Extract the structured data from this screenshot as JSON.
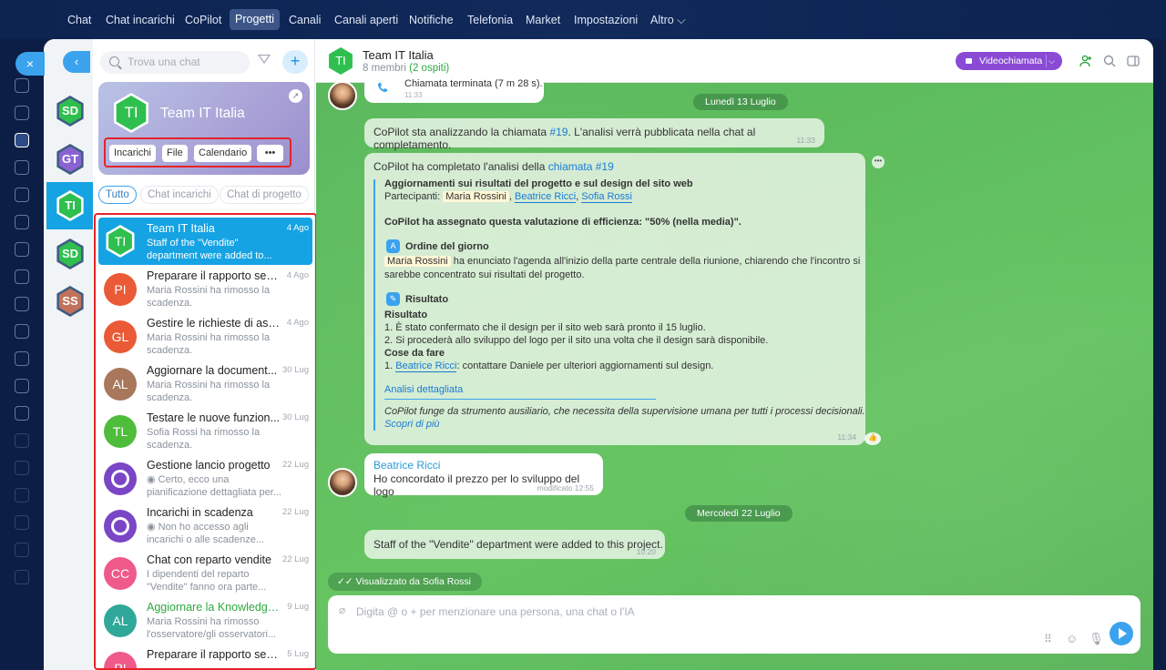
{
  "topnav": [
    "Chat",
    "Chat incarichi",
    "CoPilot",
    "Progetti",
    "Canali",
    "Canali aperti",
    "Notifiche",
    "Telefonia",
    "Market",
    "Impostazioni",
    "Altro ⌵"
  ],
  "active_nav": "Progetti",
  "close_label": "×",
  "back_label": "‹",
  "avatars_col": [
    {
      "initials": "SD",
      "color": "#2fbf4f"
    },
    {
      "initials": "GT",
      "color": "#8a63d2"
    },
    {
      "initials": "TI",
      "color": "#2fbf4f"
    },
    {
      "initials": "SD",
      "color": "#2fbf4f"
    },
    {
      "initials": "SS",
      "color": "#c0735a"
    }
  ],
  "search": {
    "placeholder": "Trova una chat"
  },
  "add_label": "+",
  "project_card": {
    "initials": "TI",
    "title": "Team IT Italia",
    "buttons": [
      "Incarichi",
      "File",
      "Calendario",
      "•••"
    ]
  },
  "tabs": [
    "Tutto",
    "Chat incarichi",
    "Chat di progetto"
  ],
  "chats": [
    {
      "title": "Team IT Italia",
      "date": "4 Ago",
      "sub": "Staff of the \"Vendite\" department were added to...",
      "initials": "TI",
      "kind": "hex",
      "selected": true
    },
    {
      "title": "Preparare il rapporto setti...",
      "date": "4 Ago",
      "sub": "Maria Rossini ha rimosso la scadenza.",
      "initials": "PI",
      "color": "#ea5a36"
    },
    {
      "title": "Gestire le richieste di assi...",
      "date": "4 Ago",
      "sub": "Maria Rossini ha rimosso la scadenza.",
      "initials": "GL",
      "color": "#ea5a36"
    },
    {
      "title": "Aggiornare la document...",
      "date": "30 Lug",
      "sub": "Maria Rossini ha rimosso la scadenza.",
      "initials": "AL",
      "color": "#a8775c"
    },
    {
      "title": "Testare le nuove funzion...",
      "date": "30 Lug",
      "sub": "Sofia Rossi ha rimosso la scadenza.",
      "initials": "TL",
      "color": "#4fbd3c"
    },
    {
      "title": "Gestione lancio progetto",
      "date": "22 Lug",
      "sub": "◉ Certo, ecco una pianificazione dettagliata per...",
      "kind": "bot"
    },
    {
      "title": "Incarichi in scadenza",
      "date": "22 Lug",
      "sub": "◉ Non ho accesso agli incarichi o alle scadenze...",
      "kind": "bot"
    },
    {
      "title": "Chat con reparto vendite",
      "date": "22 Lug",
      "sub": "I dipendenti del reparto \"Vendite\" fanno ora parte...",
      "initials": "CC",
      "color": "#ef5a8a"
    },
    {
      "title": "Aggiornare la Knowledge ...",
      "date": "9 Lug",
      "sub": "Maria Rossini ha rimosso l'osservatore/gli osservatori...",
      "initials": "AL",
      "color": "#2fa89a",
      "green": true
    },
    {
      "title": "Preparare il rapporto setti...",
      "date": "5 Lug",
      "sub": "",
      "initials": "PI",
      "color": "#ef5a8a"
    }
  ],
  "header": {
    "initials": "TI",
    "name": "Team IT Italia",
    "members": "8 membri",
    "guests": "(2 ospiti)",
    "video": "Videochiamata"
  },
  "messages": {
    "call_end": "Chiamata terminata (7 m 28 s).",
    "call_time": "11:33",
    "date1": "Lunedì 13 Luglio",
    "copilot1_a": "CoPilot sta analizzando la chiamata ",
    "copilot1_link": "#19",
    "copilot1_b": ". L'analisi verrà pubblicata nella chat al completamento.",
    "copilot1_time": "11:33",
    "copilot2_a": "CoPilot ha completato l'analisi della ",
    "copilot2_link": "chiamata #19",
    "r_title": "Aggiornamenti sui risultati del progetto e sul design del sito web",
    "r_part": "Partecipanti:",
    "r_p1": "Maria Rossini",
    "r_p2": "Beatrice Ricci",
    "r_p3": "Sofia Rossi",
    "r_eff": "CoPilot ha assegnato questa valutazione di efficienza: \"50% (nella media)\".",
    "r_odg": "Ordine del giorno",
    "r_odg_name": "Maria Rossini",
    "r_odg_t1": " ha enunciato l'agenda all'inizio della parte centrale della riunione, chiarendo che l'incontro si",
    "r_odg_t2": "sarebbe concentrato sui risultati del progetto.",
    "r_res": "Risultato",
    "r_res_b": "Risultato",
    "r_l1": "1. È stato confermato che il design per il sito web sarà pronto il 15 luglio.",
    "r_l2": "2. Si procederà allo sviluppo del logo per il sito una volta che il design sarà disponibile.",
    "r_todo": "Cose da fare",
    "r_t_name": "Beatrice Ricci",
    "r_t_text": ": contattare Daniele per ulteriori aggiornamenti sul design.",
    "r_more": "Analisi dettagliata",
    "r_note": "CoPilot funge da strumento ausiliario, che necessita della supervisione umana per tutti i processi decisionali.",
    "r_learn": "Scopri di più",
    "r_time": "11:34",
    "beatrice": "Beatrice Ricci",
    "beatrice_msg": "Ho concordato il prezzo per lo sviluppo del logo",
    "beatrice_time": "modificato 12:55",
    "date2": "Mercoledì 22 Luglio",
    "staff": "Staff of the \"Vendite\" department were added to this project.",
    "staff_time": "10:20",
    "seen": "Visualizzato da Sofia Rossi"
  },
  "input": {
    "placeholder": "Digita @ o + per menzionare una persona, una chat o l'IA"
  }
}
